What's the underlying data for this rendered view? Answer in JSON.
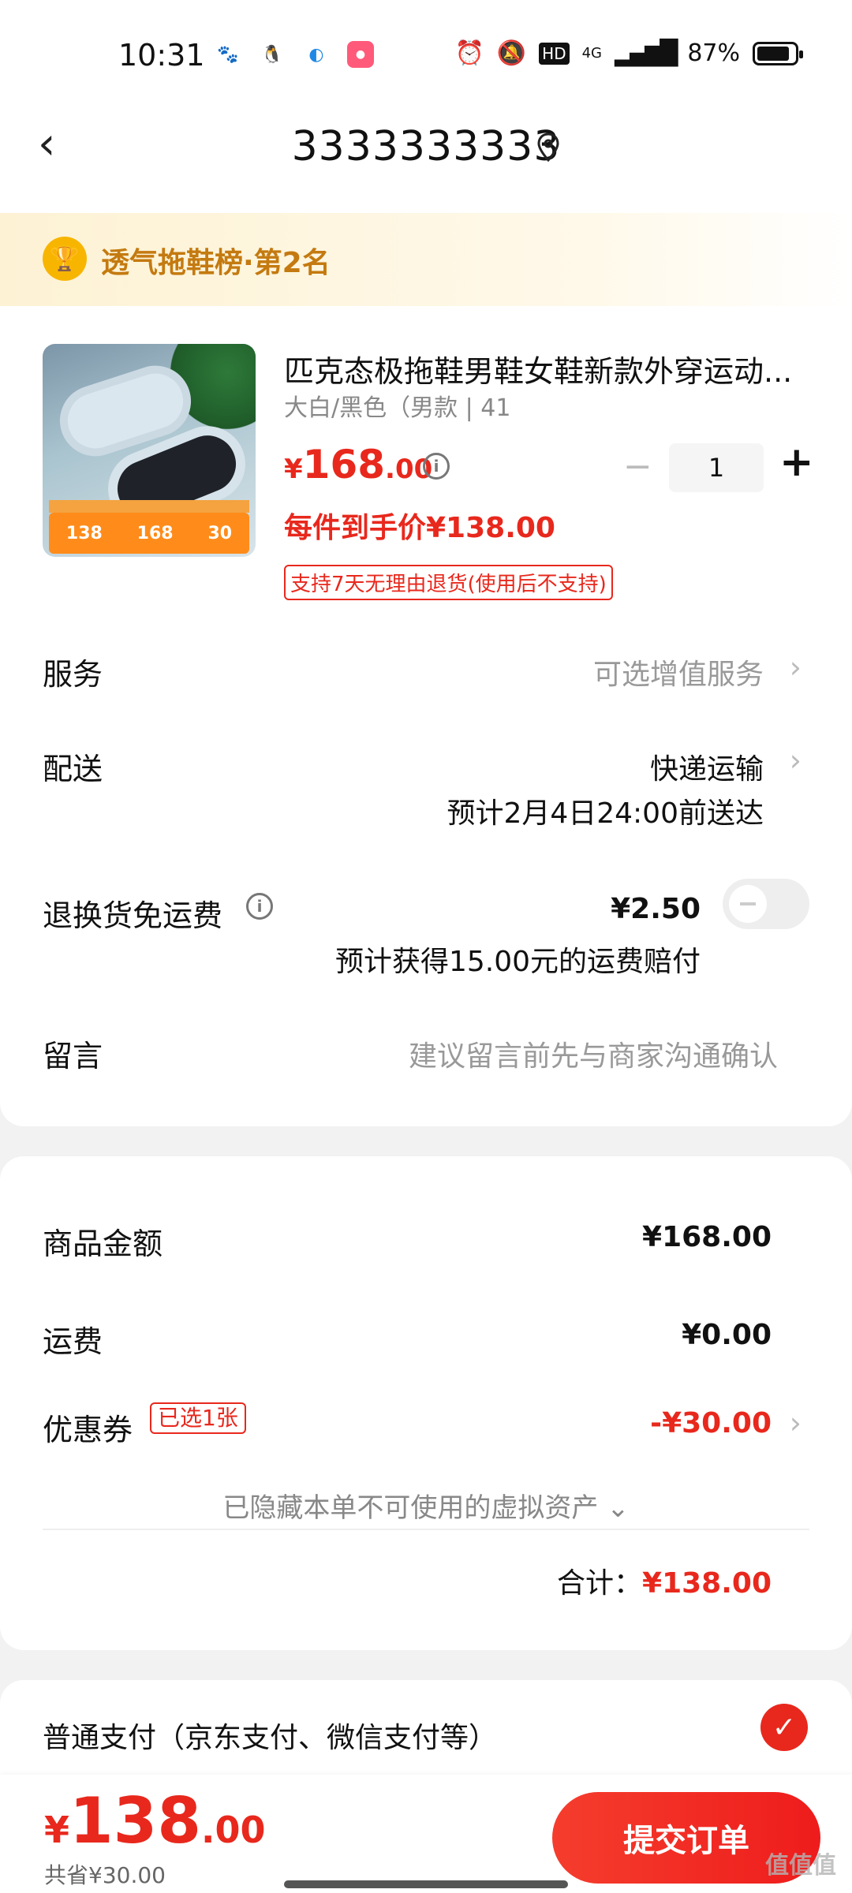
{
  "status_bar": {
    "time": "10:31",
    "apps": [
      "baidu-icon",
      "qq-icon",
      "browser-icon",
      "taobao-icon"
    ],
    "right_icons": [
      "alarm-icon",
      "mute-icon",
      "hd-icon",
      "signal-icon"
    ],
    "network": "4G",
    "battery_percent": "87%",
    "battery_level": 0.87
  },
  "nav": {
    "back_icon": "‹",
    "title": "3333333333"
  },
  "rank_banner": {
    "text": "透气拖鞋榜·第2名"
  },
  "product": {
    "title": "匹克态极拖鞋男鞋女鞋新款外穿运动...",
    "spec": "大白/黑色（男款 | 41",
    "price_currency": "¥",
    "price_int": "168",
    "price_dec": ".00",
    "qty_minus": "−",
    "quantity": "1",
    "qty_plus": "+",
    "final_price": "每件到手价¥138.00",
    "return_policy": "支持7天无理由退货(使用后不支持)",
    "thumb_price_a": "138",
    "thumb_price_b": "168",
    "thumb_price_c": "30"
  },
  "rows": {
    "service_label": "服务",
    "service_value": "可选增值服务",
    "delivery_label": "配送",
    "delivery_value": "快递运输",
    "delivery_eta": "预计2月4日24:00前送达",
    "return_fee_label": "退换货免运费",
    "return_fee_value": "¥2.50",
    "return_fee_note": "预计获得15.00元的运费赔付",
    "note_label": "留言",
    "note_placeholder": "建议留言前先与商家沟通确认"
  },
  "summary": {
    "goods_label": "商品金额",
    "goods_value": "¥168.00",
    "shipping_label": "运费",
    "shipping_value": "¥0.00",
    "coupon_label": "优惠券",
    "coupon_badge": "已选1张",
    "coupon_value": "-¥30.00",
    "hidden_assets": "已隐藏本单不可使用的虚拟资产 ⌄",
    "total_label": "合计：",
    "total_value": "¥138.00"
  },
  "payment": {
    "label": "普通支付（京东支付、微信支付等）",
    "check_icon": "✓"
  },
  "bottom": {
    "price_currency": "¥",
    "price_int": "138",
    "price_dec": ".00",
    "saved": "共省¥30.00",
    "submit_label": "提交订单"
  },
  "watermark": "值值值",
  "colors": {
    "accent_red": "#e8281d",
    "rank_gold": "#c47a10"
  }
}
